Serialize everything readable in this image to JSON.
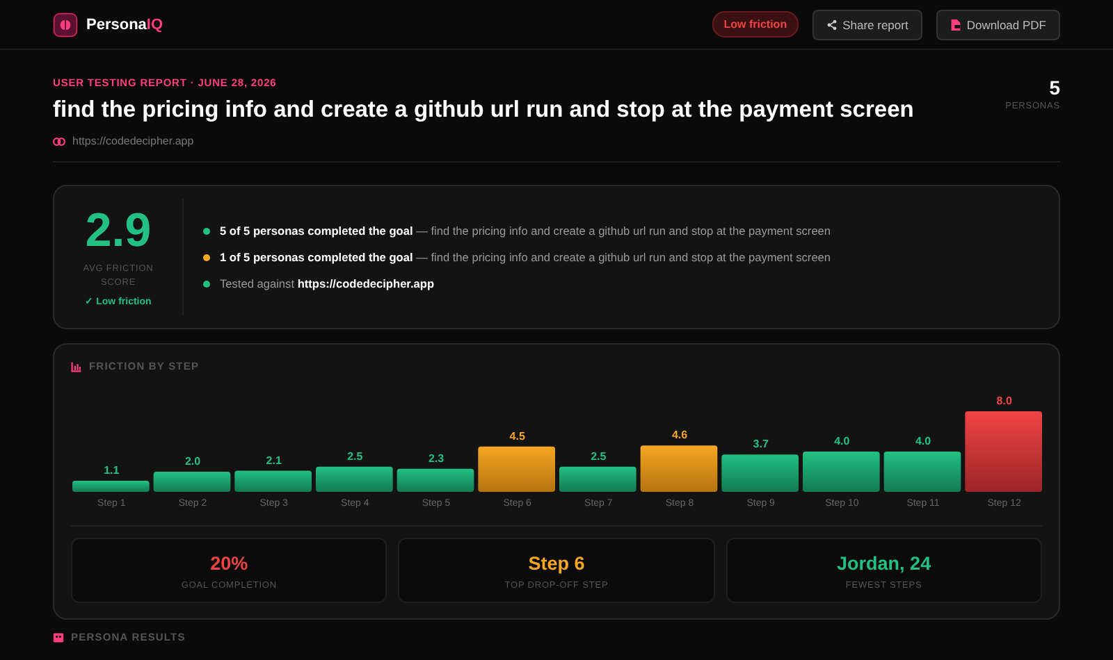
{
  "header": {
    "brand": "Persona",
    "brand_accent": "IQ",
    "badge": "Low friction",
    "buttons": [
      {
        "label": "Share report",
        "kind": "share"
      },
      {
        "label": "Download PDF",
        "kind": "pdf"
      }
    ]
  },
  "report": {
    "eyebrow": "USER TESTING REPORT · JUNE 28, 2026",
    "title": "find the pricing info and create a github url run and stop at the payment screen",
    "url": "https://codedecipher.app",
    "persona_count": "5",
    "persona_label": "PERSONAS"
  },
  "summary": {
    "score": "2.9",
    "score_label": "AVG FRICTION SCORE",
    "verdict": "✓ Low friction",
    "items": [
      {
        "text": "**5 of 5 personas completed the goal** — find the pricing info and create a github url run and stop at the payment screen",
        "color": "#22c083"
      },
      {
        "text": "**1 of 5 personas completed the goal** — find the pricing info and create a github url run and stop at the payment screen",
        "color": "#f5a623"
      },
      {
        "text": "Tested against **https://codedecipher.app**",
        "color": "#22c083"
      }
    ]
  },
  "friction": {
    "title": "FRICTION BY STEP",
    "chart_data": {
      "type": "bar",
      "categories": [
        "Step 1",
        "Step 2",
        "Step 3",
        "Step 4",
        "Step 5",
        "Step 6",
        "Step 7",
        "Step 8",
        "Step 9",
        "Step 10",
        "Step 11",
        "Step 12"
      ],
      "values": [
        1.1,
        2.0,
        2.1,
        2.5,
        2.3,
        4.5,
        2.5,
        4.6,
        3.7,
        4.0,
        4.0,
        8.0
      ],
      "value_labels": [
        "1.1",
        "2.0",
        "2.1",
        "2.5",
        "2.3",
        "4.5",
        "2.5",
        "4.6",
        "3.7",
        "4.0",
        "4.0",
        "8.0"
      ]
    },
    "stats": [
      {
        "value": "20%",
        "label": "GOAL COMPLETION",
        "color": "#f04444"
      },
      {
        "value": "Step 6",
        "label": "TOP DROP-OFF STEP",
        "color": "#f5a623"
      },
      {
        "value": "Jordan, 24",
        "label": "FEWEST STEPS",
        "color": "#22c083"
      }
    ]
  },
  "persona_results": {
    "title": "PERSONA RESULTS"
  }
}
